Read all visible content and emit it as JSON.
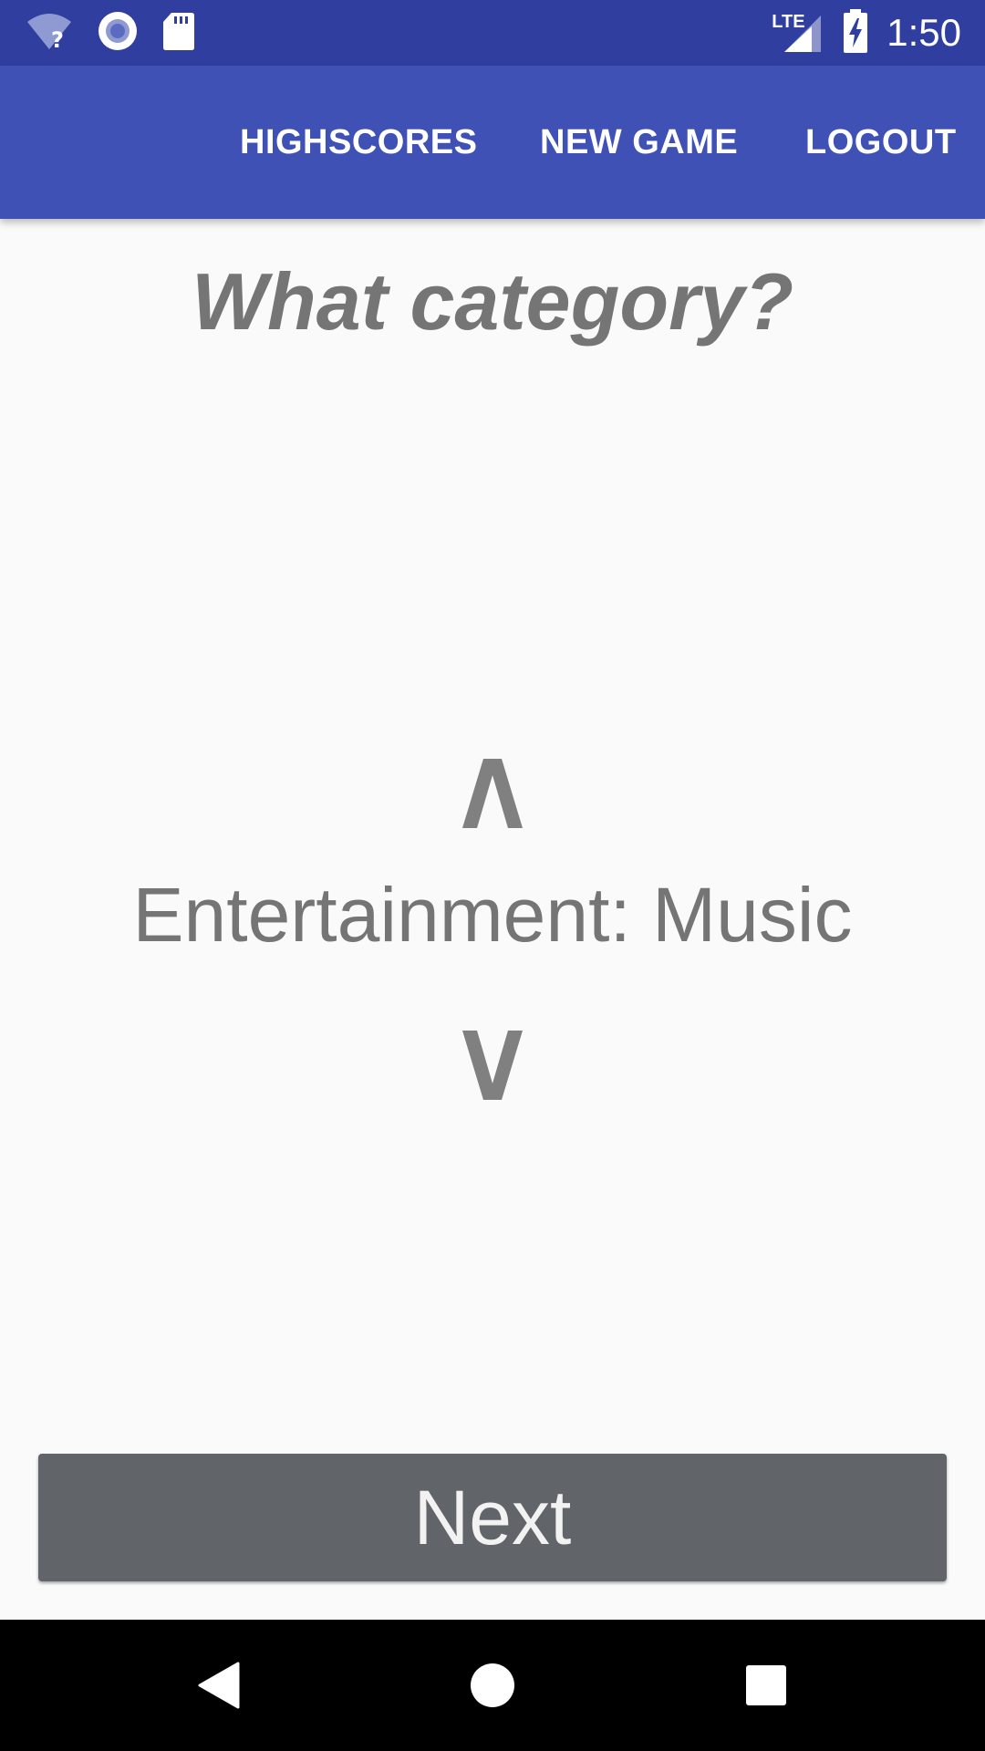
{
  "status_bar": {
    "time": "1:50",
    "network_label": "LTE",
    "icons": [
      "wifi-unknown-icon",
      "sync-circle-icon",
      "sd-card-icon",
      "lte-signal-icon",
      "battery-charging-icon"
    ]
  },
  "app_bar": {
    "actions": [
      "HIGHSCORES",
      "NEW GAME",
      "LOGOUT"
    ]
  },
  "main": {
    "question": "What category?",
    "selected_category": "Entertainment: Music",
    "up_arrow": "up-chevron-icon",
    "down_arrow": "down-chevron-icon"
  },
  "next_button": {
    "label": "Next"
  },
  "nav_bar": {
    "icons": [
      "back-icon",
      "home-icon",
      "recents-icon"
    ]
  },
  "colors": {
    "status_bar": "#303f9f",
    "app_bar": "#3f51b5",
    "background": "#fafafa",
    "text_gray": "#757575",
    "button": "#616569"
  }
}
